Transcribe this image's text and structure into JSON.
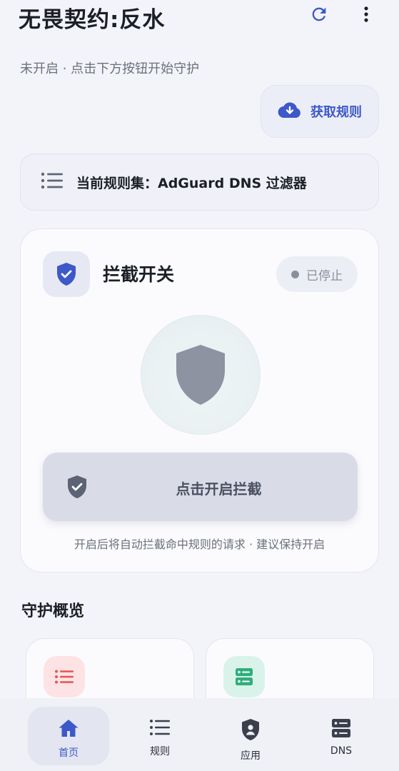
{
  "header": {
    "title": "无畏契约:反水",
    "subtitle": "未开启 · 点击下方按钮开始守护",
    "refresh_icon": "refresh-icon",
    "more_icon": "more-vertical-icon"
  },
  "fetch_button": {
    "label": "获取规则",
    "icon": "cloud-download-icon"
  },
  "ruleset": {
    "text": "当前规则集：AdGuard DNS 过滤器",
    "icon": "list-icon"
  },
  "intercept": {
    "title": "拦截开关",
    "status": "已停止",
    "button_label": "点击开启拦截",
    "hint": "开启后将自动拦截命中规则的请求 · 建议保持开启"
  },
  "overview": {
    "title": "守护概览"
  },
  "nav": {
    "items": [
      {
        "label": "首页",
        "icon": "home-icon"
      },
      {
        "label": "规则",
        "icon": "list-icon"
      },
      {
        "label": "应用",
        "icon": "shield-user-icon"
      },
      {
        "label": "DNS",
        "icon": "server-icon"
      }
    ]
  },
  "colors": {
    "accent": "#3d58c8",
    "status_grey": "#8a8f9c",
    "red_tint": "#fde3e4",
    "green_tint": "#d9f3ea"
  }
}
